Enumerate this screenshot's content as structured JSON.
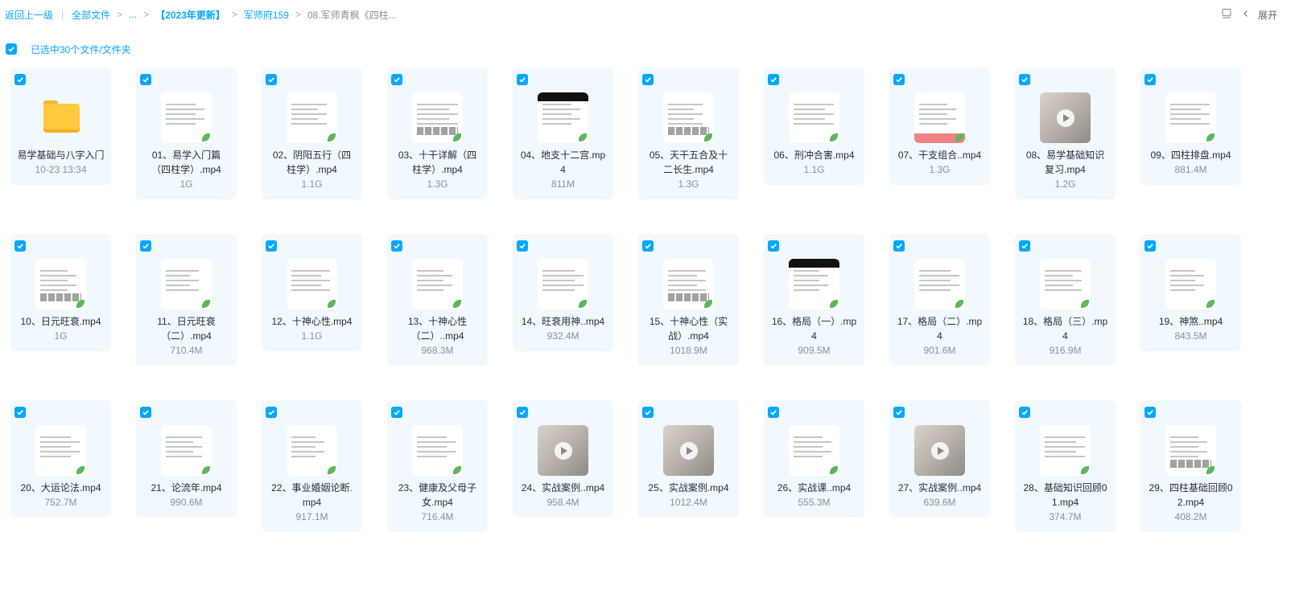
{
  "breadcrumb": {
    "back": "返回上一级",
    "all_files": "全部文件",
    "ellipsis": "...",
    "folder_2023": "【2023年更新】",
    "folder_jsf": "军师府159",
    "current": "08.军师青枫《四柱..."
  },
  "topright": {
    "expand_label": "展开"
  },
  "selection": {
    "label": "已选中30个文件/文件夹"
  },
  "colors": {
    "accent": "#06a7ff",
    "card_bg": "#f1f8fe",
    "folder": "#ffc940"
  },
  "items": [
    {
      "name": "易学基础与八字入门",
      "meta": "10-23 13:34",
      "kind": "folder"
    },
    {
      "name": "01、易学入门篇（四柱学）.mp4",
      "meta": "1G",
      "kind": "doc"
    },
    {
      "name": "02、阴阳五行（四柱学）.mp4",
      "meta": "1.1G",
      "kind": "doc"
    },
    {
      "name": "03、十干详解（四柱学）.mp4",
      "meta": "1.3G",
      "kind": "table"
    },
    {
      "name": "04、地支十二宫.mp4",
      "meta": "811M",
      "kind": "dark"
    },
    {
      "name": "05、天干五合及十二长生.mp4",
      "meta": "1.3G",
      "kind": "table"
    },
    {
      "name": "06、刑冲合害.mp4",
      "meta": "1.1G",
      "kind": "doc"
    },
    {
      "name": "07、干支组合..mp4",
      "meta": "1.3G",
      "kind": "red"
    },
    {
      "name": "08、易学基础知识复习.mp4",
      "meta": "1.2G",
      "kind": "photo"
    },
    {
      "name": "09、四柱排盘.mp4",
      "meta": "881.4M",
      "kind": "doc"
    },
    {
      "name": "10、日元旺衰.mp4",
      "meta": "1G",
      "kind": "table"
    },
    {
      "name": "11、日元旺衰（二）.mp4",
      "meta": "710.4M",
      "kind": "doc"
    },
    {
      "name": "12、十神心性.mp4",
      "meta": "1.1G",
      "kind": "doc"
    },
    {
      "name": "13、十神心性（二）..mp4",
      "meta": "968.3M",
      "kind": "doc"
    },
    {
      "name": "14、旺衰用神..mp4",
      "meta": "932.4M",
      "kind": "doc"
    },
    {
      "name": "15、十神心性（实战）.mp4",
      "meta": "1018.9M",
      "kind": "table"
    },
    {
      "name": "16、格局（一）.mp4",
      "meta": "909.5M",
      "kind": "dark"
    },
    {
      "name": "17、格局（二）.mp4",
      "meta": "901.6M",
      "kind": "doc"
    },
    {
      "name": "18、格局（三）.mp4",
      "meta": "916.9M",
      "kind": "doc"
    },
    {
      "name": "19、神煞..mp4",
      "meta": "843.5M",
      "kind": "doc"
    },
    {
      "name": "20、大运论法.mp4",
      "meta": "752.7M",
      "kind": "doc"
    },
    {
      "name": "21、论流年.mp4",
      "meta": "990.6M",
      "kind": "doc"
    },
    {
      "name": "22、事业婚姻论断.mp4",
      "meta": "917.1M",
      "kind": "doc"
    },
    {
      "name": "23、健康及父母子女.mp4",
      "meta": "716.4M",
      "kind": "doc"
    },
    {
      "name": "24、实战案例..mp4",
      "meta": "958.4M",
      "kind": "photo"
    },
    {
      "name": "25、实战案例.mp4",
      "meta": "1012.4M",
      "kind": "photo"
    },
    {
      "name": "26、实战课..mp4",
      "meta": "555.3M",
      "kind": "doc"
    },
    {
      "name": "27、实战案例..mp4",
      "meta": "639.6M",
      "kind": "photo"
    },
    {
      "name": "28、基础知识回顾01.mp4",
      "meta": "374.7M",
      "kind": "doc"
    },
    {
      "name": "29、四柱基础回顾02.mp4",
      "meta": "408.2M",
      "kind": "table"
    }
  ]
}
